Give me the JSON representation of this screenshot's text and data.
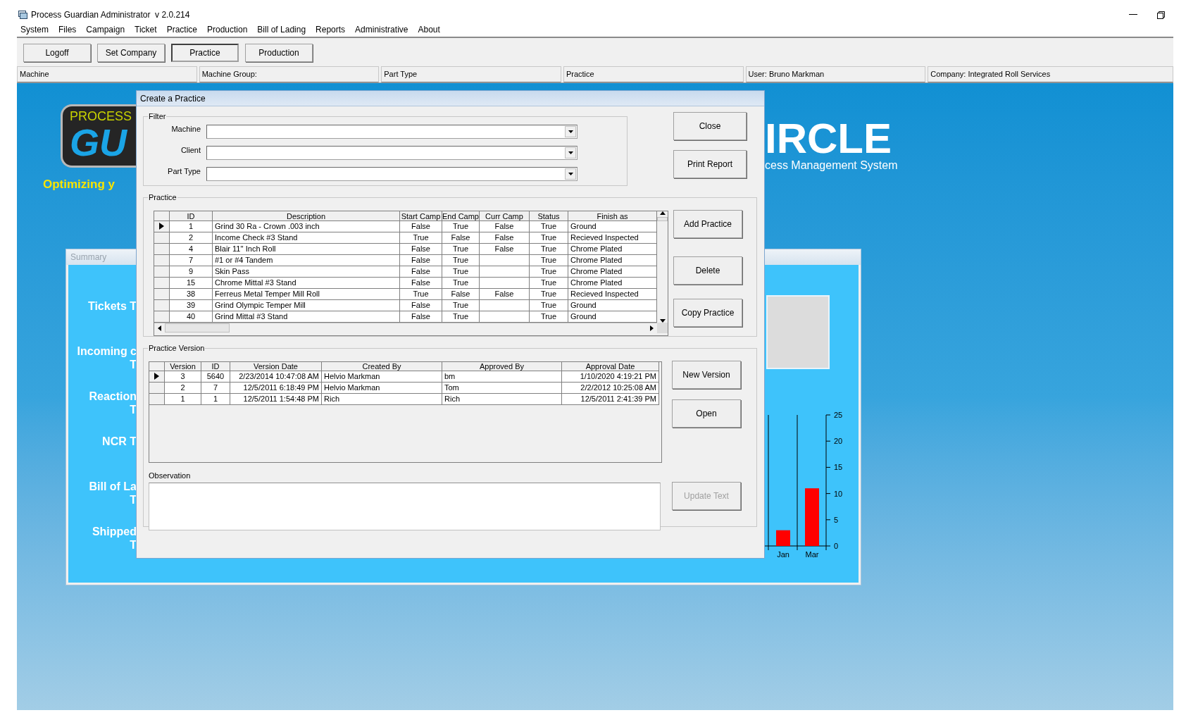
{
  "window": {
    "title": "Process Guardian Administrator  v 2.0.214"
  },
  "menu": [
    "System",
    "Files",
    "Campaign",
    "Ticket",
    "Practice",
    "Production",
    "Bill of Lading",
    "Reports",
    "Administrative",
    "About"
  ],
  "toolbar": [
    {
      "label": "Logoff",
      "selected": false
    },
    {
      "label": "Set Company",
      "selected": false
    },
    {
      "label": "Practice",
      "selected": true
    },
    {
      "label": "Production",
      "selected": false
    }
  ],
  "status_fields": [
    "Machine",
    "Machine Group:",
    "Part Type",
    "Practice",
    "User: Bruno Markman",
    "Company: Integrated Roll Services"
  ],
  "background": {
    "logo": {
      "line_1": "PROCESS",
      "line_2": "GU",
      "tagline": "Optimizing y"
    },
    "brand": {
      "name": "IRCLE",
      "subtitle": "cess Management System"
    },
    "summary": {
      "title": "Summary",
      "labels": [
        {
          "lines": [
            "Tickets T"
          ]
        },
        {
          "lines": [
            "Incoming c",
            "T"
          ]
        },
        {
          "lines": [
            "Reaction",
            "T"
          ]
        },
        {
          "lines": [
            "NCR T"
          ]
        },
        {
          "lines": [
            "Bill of La",
            "T"
          ]
        },
        {
          "lines": [
            "Shipped",
            "T"
          ]
        }
      ],
      "chart_data": {
        "type": "bar",
        "categories": [
          "Jan",
          "Mar"
        ],
        "series": [
          {
            "color": "#ff0000",
            "values": [
              3,
              11
            ]
          }
        ],
        "ylim": [
          0,
          25
        ],
        "yticks": [
          0,
          5,
          10,
          15,
          20,
          25
        ]
      }
    }
  },
  "dialog": {
    "title": "Create a Practice",
    "filter": {
      "title": "Filter",
      "fields": [
        {
          "label": "Machine"
        },
        {
          "label": "Client"
        },
        {
          "label": "Part Type"
        }
      ]
    },
    "top_buttons": [
      {
        "label": "Close",
        "disabled": false
      },
      {
        "label": "Print Report",
        "disabled": false
      }
    ],
    "practice": {
      "title": "Practice",
      "columns": [
        "ID",
        "Description",
        "Start Camp",
        "End Camp",
        "Curr Camp",
        "Status",
        "Finish as"
      ],
      "rows": [
        {
          "selected": true,
          "cells": [
            "1",
            "Grind 30 Ra - Crown .003 inch",
            "False",
            "True",
            "False",
            "True",
            "Ground"
          ]
        },
        {
          "selected": false,
          "cells": [
            "2",
            "Income Check #3 Stand",
            "True",
            "False",
            "False",
            "True",
            "Recieved Inspected"
          ]
        },
        {
          "selected": false,
          "cells": [
            "4",
            "Blair 11'' Inch Roll",
            "False",
            "True",
            "False",
            "True",
            "Chrome Plated"
          ]
        },
        {
          "selected": false,
          "cells": [
            "7",
            "#1 or #4 Tandem",
            "False",
            "True",
            null,
            "True",
            "Chrome Plated"
          ]
        },
        {
          "selected": false,
          "cells": [
            "9",
            "Skin Pass",
            "False",
            "True",
            null,
            "True",
            "Chrome Plated"
          ]
        },
        {
          "selected": false,
          "cells": [
            "15",
            "Chrome Mittal #3 Stand",
            "False",
            "True",
            null,
            "True",
            "Chrome Plated"
          ]
        },
        {
          "selected": false,
          "cells": [
            "38",
            "Ferreus Metal Temper Mill Roll",
            "True",
            "False",
            "False",
            "True",
            "Recieved Inspected"
          ]
        },
        {
          "selected": false,
          "cells": [
            "39",
            "Grind Olympic Temper Mill",
            "False",
            "True",
            null,
            "True",
            "Ground"
          ]
        },
        {
          "selected": false,
          "cells": [
            "40",
            "Grind Mittal #3 Stand",
            "False",
            "True",
            null,
            "True",
            "Ground"
          ]
        }
      ],
      "buttons": [
        {
          "label": "Add Practice",
          "disabled": false
        },
        {
          "label": "Delete",
          "disabled": false
        },
        {
          "label": "Copy Practice",
          "disabled": false
        }
      ]
    },
    "version": {
      "title": "Practice Version",
      "columns": [
        "Version",
        "ID",
        "Version Date",
        "Created By",
        "Approved By",
        "Approval Date"
      ],
      "rows": [
        {
          "selected": true,
          "cells": [
            "3",
            "5640",
            "2/23/2014 10:47:08 AM",
            "Helvio Markman",
            "bm",
            "1/10/2020 4:19:21 PM"
          ]
        },
        {
          "selected": false,
          "cells": [
            "2",
            "7",
            "12/5/2011 6:18:49 PM",
            "Helvio Markman",
            "Tom",
            "2/2/2012 10:25:08 AM"
          ]
        },
        {
          "selected": false,
          "cells": [
            "1",
            "1",
            "12/5/2011 1:54:48 PM",
            "Rich",
            "Rich",
            "12/5/2011 2:41:39 PM"
          ]
        }
      ],
      "observation_label": "Observation",
      "buttons": [
        {
          "label": "New Version",
          "disabled": false
        },
        {
          "label": "Open",
          "disabled": false
        },
        {
          "label": "Update Text",
          "disabled": true
        }
      ]
    }
  }
}
